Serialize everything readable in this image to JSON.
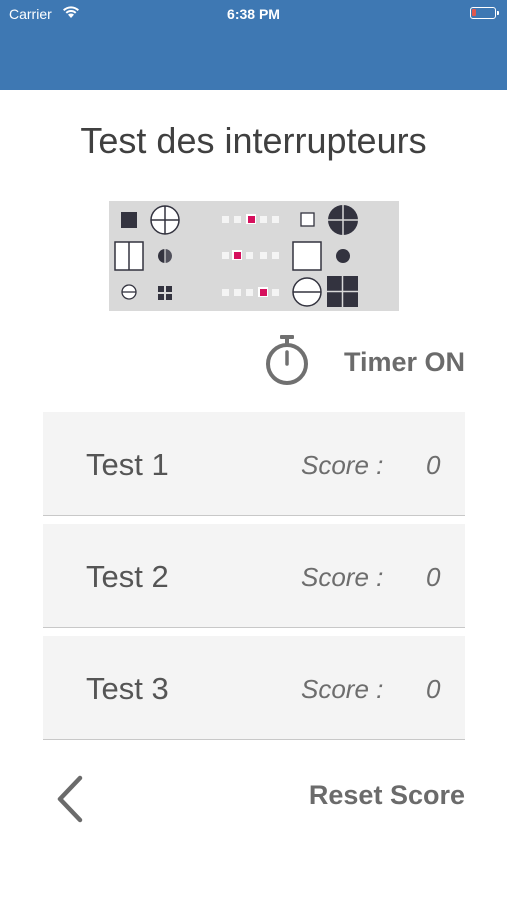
{
  "status_bar": {
    "carrier": "Carrier",
    "time": "6:38 PM"
  },
  "title": "Test des interrupteurs",
  "timer": {
    "label": "Timer ON",
    "icon": "stopwatch-icon"
  },
  "tests": [
    {
      "label": "Test 1",
      "score_label": "Score :",
      "score": "0"
    },
    {
      "label": "Test 2",
      "score_label": "Score :",
      "score": "0"
    },
    {
      "label": "Test 3",
      "score_label": "Score :",
      "score": "0"
    }
  ],
  "footer": {
    "back_icon": "chevron-left-icon",
    "reset_label": "Reset Score"
  },
  "colors": {
    "header": "#3e78b3",
    "card": "#f4f4f4",
    "text": "#555555",
    "accent": "#d6105d",
    "shape": "#33333f"
  }
}
